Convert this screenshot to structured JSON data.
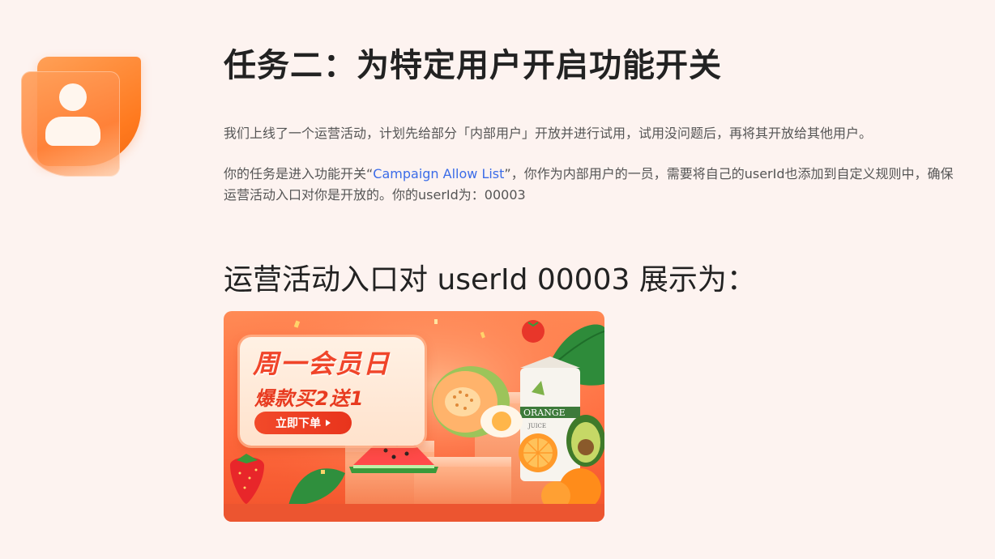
{
  "header": {
    "title": "任务二：为特定用户开启功能开关"
  },
  "description": {
    "p1": "我们上线了一个运营活动，计划先给部分「内部用户」开放并进行试用，试用没问题后，再将其开放给其他用户。",
    "p2_before": "你的任务是进入功能开关“",
    "p2_link": "Campaign Allow List",
    "p2_after": "”，你作为内部用户的一员，需要将自己的userId也添加到自定义规则中，确保运营活动入口对你是开放的。你的userId为：00003"
  },
  "section": {
    "subtitle": "运营活动入口对 userId 00003 展示为："
  },
  "banner": {
    "headline": "周一会员日",
    "subline": "爆款买2送1",
    "cta_label": "立即下单",
    "juice_brand": "ORANGE",
    "juice_sub": "JUICE"
  },
  "icons": {
    "user": "user-avatar-icon",
    "arrow": "chevron-right-icon"
  },
  "colors": {
    "background": "#fdf3f0",
    "accent": "#ff7a1f",
    "link": "#3b6ce8",
    "banner_red": "#f24a2a"
  }
}
